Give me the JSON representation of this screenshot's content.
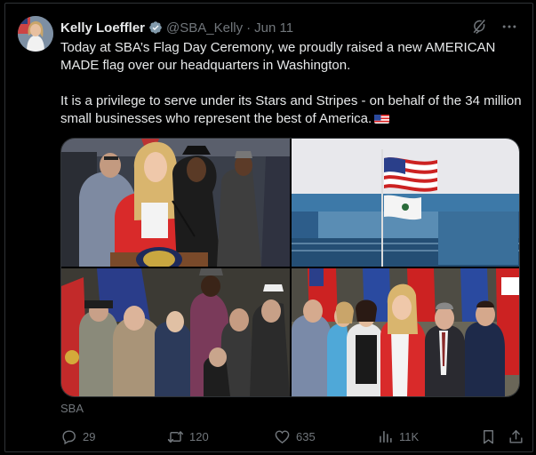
{
  "tweet": {
    "author_name": "Kelly Loeffler",
    "handle": "@SBA_Kelly",
    "separator": "·",
    "date": "Jun 11",
    "paragraph1": "Today at SBA’s Flag Day Ceremony, we proudly raised a new AMERICAN MADE flag over our headquarters in Washington.",
    "paragraph2": "It is a privilege to serve under its Stars and Stripes - on behalf of the 34 million small businesses who represent the best of America.",
    "source_label": "SBA"
  },
  "media": {
    "count": 4
  },
  "actions": {
    "replies": "29",
    "reposts": "120",
    "likes": "635",
    "views": "11K"
  },
  "icons": {
    "verified": "verified-badge-icon",
    "grok": "grok-icon",
    "more": "more-icon",
    "reply": "reply-icon",
    "repost": "repost-icon",
    "like": "heart-icon",
    "views": "views-icon",
    "bookmark": "bookmark-icon",
    "share": "share-icon"
  },
  "colors": {
    "background": "#000000",
    "text": "#e7e9ea",
    "muted": "#71767b",
    "verified": "#829aab"
  }
}
